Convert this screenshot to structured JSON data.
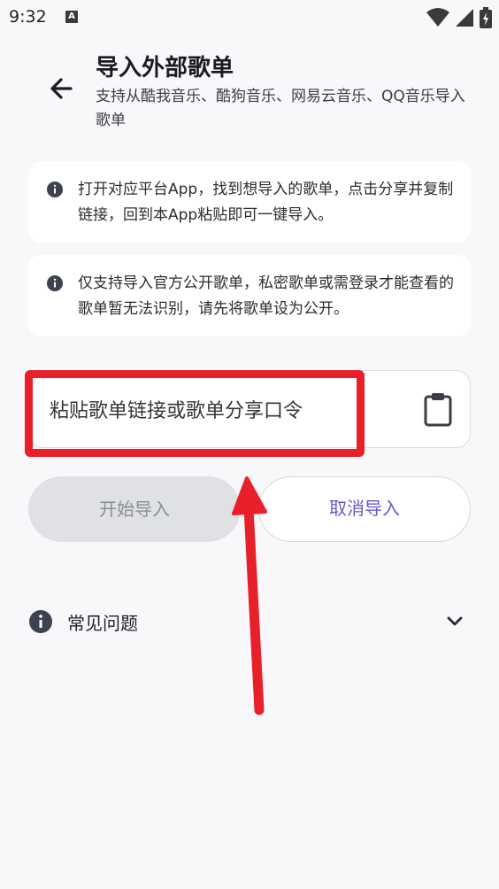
{
  "status_bar": {
    "time": "9:32",
    "notification_icon": "a-notification-icon"
  },
  "header": {
    "title": "导入外部歌单",
    "subtitle": "支持从酷我音乐、酷狗音乐、网易云音乐、QQ音乐导入歌单"
  },
  "tips": [
    {
      "icon": "info-icon",
      "text": "打开对应平台App，找到想导入的歌单，点击分享并复制链接，回到本App粘贴即可一键导入。"
    },
    {
      "icon": "info-icon",
      "text": "仅支持导入官方公开歌单，私密歌单或需登录才能查看的歌单暂无法识别，请先将歌单设为公开。"
    }
  ],
  "link_input": {
    "value": "",
    "placeholder": "粘贴歌单链接或歌单分享口令"
  },
  "buttons": {
    "start": "开始导入",
    "cancel": "取消导入"
  },
  "faq": {
    "label": "常见问题"
  },
  "colors": {
    "accent": "#6a55c8",
    "annotation": "#e8202a",
    "disabled_bg": "#dfe1e5"
  }
}
